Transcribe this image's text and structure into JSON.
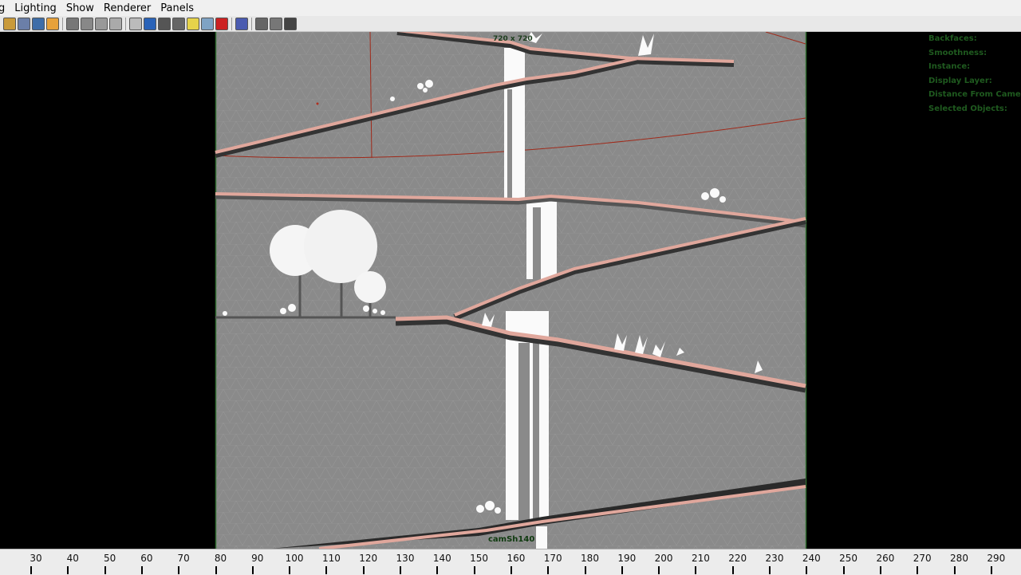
{
  "menu": {
    "items": [
      "g",
      "Lighting",
      "Show",
      "Renderer",
      "Panels"
    ]
  },
  "toolbar": {
    "icons": [
      "select-camera-icon",
      "camera-attributes-icon",
      "bookmark-icon",
      "image-plane-icon",
      "grid-icon",
      "film-gate-icon",
      "resolution-gate-icon",
      "safe-title-icon",
      "wireframe-icon",
      "smooth-shade-icon",
      "shaded-wireframe-icon",
      "default-material-icon",
      "lights-icon",
      "shadows-icon",
      "high-quality-icon",
      "isolate-select-icon",
      "xray-icon",
      "xray-joints-icon",
      "xray-active-icon"
    ]
  },
  "viewport": {
    "resolution_label": "720 x 720",
    "camera_label": "camSh140",
    "hud": [
      "Backfaces:",
      "Smoothness:",
      "Instance:",
      "Display Layer:",
      "Distance From Camera:",
      "Selected Objects:"
    ]
  },
  "timeline": {
    "labels": [
      "30",
      "40",
      "50",
      "60",
      "70",
      "80",
      "90",
      "100",
      "110",
      "120",
      "130",
      "140",
      "150",
      "160",
      "170",
      "180",
      "190",
      "200",
      "210",
      "220",
      "230",
      "240",
      "250",
      "260",
      "270",
      "280",
      "290"
    ]
  },
  "colors": {
    "background": "#000000",
    "ground": "#8a8a8a",
    "ramp": "#e0a79c",
    "hud_text": "#1f5a1f",
    "gate": "#2f6b2f"
  }
}
